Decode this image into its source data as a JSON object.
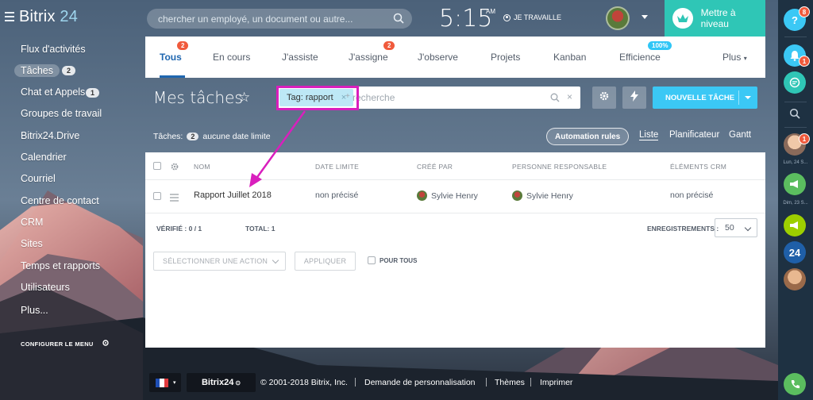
{
  "header": {
    "logo_text": "Bitrix",
    "logo_num": "24",
    "search_placeholder": "chercher un employé, un document ou autre...",
    "clock": "5:15",
    "ampm": "AM",
    "work_status": "JE TRAVAILLE",
    "upgrade_label": "Mettre à niveau"
  },
  "sidebar": {
    "items": [
      {
        "label": "Flux d'activités"
      },
      {
        "label": "Tâches",
        "badge": "2"
      },
      {
        "label": "Chat et Appels",
        "badge": "1"
      },
      {
        "label": "Groupes de travail"
      },
      {
        "label": "Bitrix24.Drive"
      },
      {
        "label": "Calendrier"
      },
      {
        "label": "Courriel"
      },
      {
        "label": "Centre de contact"
      },
      {
        "label": "CRM"
      },
      {
        "label": "Sites"
      },
      {
        "label": "Temps et rapports"
      },
      {
        "label": "Utilisateurs"
      },
      {
        "label": "Plus..."
      }
    ],
    "config_label": "CONFIGURER LE MENU"
  },
  "tabs": [
    {
      "label": "Tous",
      "badge": "2",
      "active": true
    },
    {
      "label": "En cours"
    },
    {
      "label": "J'assiste"
    },
    {
      "label": "J'assigne",
      "badge": "2"
    },
    {
      "label": "J'observe"
    },
    {
      "label": "Projets"
    },
    {
      "label": "Kanban"
    },
    {
      "label": "Efficience",
      "badge": "100%"
    },
    {
      "label": "Plus"
    }
  ],
  "toolbar": {
    "title": "Mes tâches",
    "filter_tag": "Tag: rapport",
    "filter_tag_close": "×",
    "filter_plus": "+",
    "filter_placeholder": "recherche",
    "filter_clear": "×",
    "new_task_label": "NOUVELLE TÂCHE",
    "count_label": "Tâches:",
    "count_value": "2",
    "count_suffix": "aucune date limite",
    "automation_label": "Automation rules",
    "views": [
      "Liste",
      "Planificateur",
      "Gantt"
    ]
  },
  "table": {
    "columns": [
      "NOM",
      "DATE LIMITE",
      "CRÉÉ PAR",
      "PERSONNE RESPONSABLE",
      "ÉLÉMENTS CRM"
    ],
    "rows": [
      {
        "name": "Rapport Juillet 2018",
        "deadline": "non précisé",
        "created_by": "Sylvie Henry",
        "responsible": "Sylvie Henry",
        "crm": "non précisé"
      }
    ],
    "verified_label": "VÉRIFIÉ : 0 / 1",
    "total_label": "TOTAL: 1",
    "records_label": "ENREGISTREMENTS :",
    "page_size": "50",
    "action_placeholder": "SÉLECTIONNER UNE ACTION",
    "apply_label": "APPLIQUER",
    "for_all_label": "POUR TOUS"
  },
  "footer": {
    "b24_label": "Bitrix24",
    "copyright": "© 2001-2018 Bitrix, Inc.",
    "links": [
      "Demande de personnalisation",
      "Thèmes",
      "Imprimer"
    ]
  },
  "right_panel": {
    "help_badge": "8",
    "notif_badge": "1",
    "chat_badge": "1",
    "date1": "Lun, 24 S...",
    "date2": "Dim, 23 S...",
    "b24_label": "24"
  },
  "colors": {
    "accent": "#2067b0",
    "upgrade": "#2fc6b6",
    "new_task": "#3bc8f5",
    "highlight": "#d91fbd",
    "badge": "#f05a3c"
  }
}
